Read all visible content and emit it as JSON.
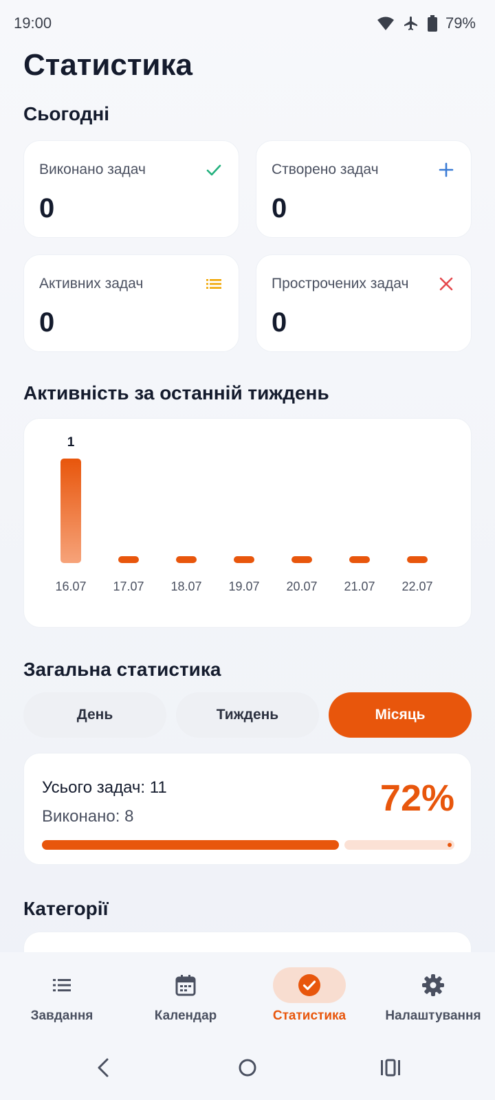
{
  "status_bar": {
    "time": "19:00",
    "battery": "79%"
  },
  "page_title": "Статистика",
  "today": {
    "title": "Сьогодні",
    "cards": [
      {
        "label": "Виконано задач",
        "value": "0",
        "icon": "check-icon",
        "color": "#22b07d"
      },
      {
        "label": "Створено задач",
        "value": "0",
        "icon": "plus-icon",
        "color": "#3a7bd5"
      },
      {
        "label": "Активних задач",
        "value": "0",
        "icon": "list-icon",
        "color": "#f0a500"
      },
      {
        "label": "Прострочених задач",
        "value": "0",
        "icon": "close-icon",
        "color": "#e5484d"
      }
    ]
  },
  "activity": {
    "title": "Активність за останній тиждень"
  },
  "chart_data": {
    "type": "bar",
    "categories": [
      "16.07",
      "17.07",
      "18.07",
      "19.07",
      "20.07",
      "21.07",
      "22.07"
    ],
    "values": [
      1,
      0,
      0,
      0,
      0,
      0,
      0
    ],
    "data_labels": [
      "1",
      "",
      "",
      "",
      "",
      "",
      ""
    ],
    "ylim": [
      0,
      1
    ],
    "grid": false,
    "bar_color": "#e8560c"
  },
  "overall": {
    "title": "Загальна статистика",
    "tabs": [
      {
        "label": "День",
        "active": false
      },
      {
        "label": "Тиждень",
        "active": false
      },
      {
        "label": "Місяць",
        "active": true
      }
    ],
    "total_label": "Усього задач: 11",
    "done_label": "Виконано: 8",
    "percent_label": "72%",
    "progress": 0.72
  },
  "categories": {
    "title": "Категорії"
  },
  "bottom_nav": {
    "items": [
      {
        "label": "Завдання",
        "icon": "list-icon",
        "active": false
      },
      {
        "label": "Календар",
        "icon": "calendar-icon",
        "active": false
      },
      {
        "label": "Статистика",
        "icon": "check-circle-icon",
        "active": true
      },
      {
        "label": "Налаштування",
        "icon": "gear-icon",
        "active": false
      }
    ]
  },
  "colors": {
    "accent": "#e8560c",
    "accent_light": "#fbe1d5"
  }
}
